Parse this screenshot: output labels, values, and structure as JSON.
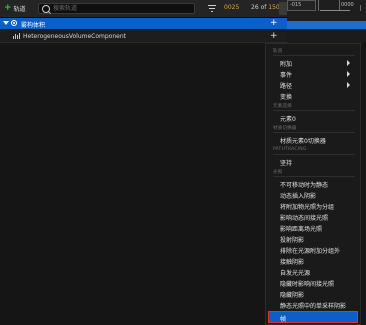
{
  "toolbar": {
    "add_track_label": "轨道",
    "search_placeholder": "搜索轨道",
    "current_frame": "0025",
    "range_current": "26",
    "range_of": "of",
    "range_end": "150"
  },
  "timeline": {
    "tick_a": "-015",
    "tick_b": "0000"
  },
  "tracks": [
    {
      "label": "雾构体积"
    },
    {
      "label": "HeterogeneousVolumeComponent"
    }
  ],
  "context_menu": {
    "sections": {
      "track": "轨道",
      "element": "元素选择",
      "material_switcher": "材质切换器",
      "pathtracing": "PATHTRACING",
      "light": "光照",
      "frame": "帧率"
    },
    "items": {
      "attach": "附加",
      "event": "事件",
      "path": "路径",
      "transform": "变换",
      "element0": "元素0",
      "material_switcher": "材质元素0切换器",
      "hold": "坚持",
      "cannot_move_static": "不可移动时为静态",
      "dynamic_inset_shadow": "动态插入阴影",
      "lightmap_as_group": "将附加物光照为分组",
      "affect_dynamic_indirect": "影响动态间接光照",
      "affect_distance_light": "影响距离场光照",
      "cast_shadow": "投射阴影",
      "exclude_light_group": "排除在光源附加分组外",
      "contact_shadow": "接触阴影",
      "self_light": "自发光光源",
      "hidden_affect_indirect": "隐藏时影响间接光照",
      "hidden_shadow": "隐藏阴影",
      "static_single_sample": "静态光照中的单采样阴影",
      "frame": "帧"
    }
  }
}
